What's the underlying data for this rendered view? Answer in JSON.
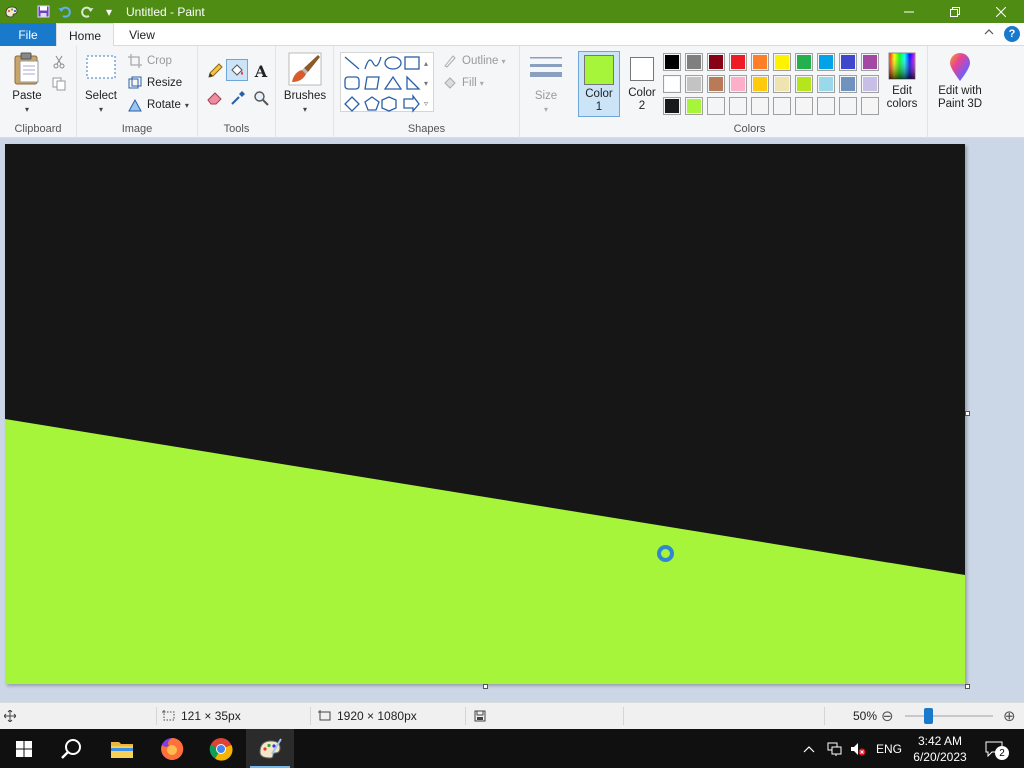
{
  "window": {
    "title": "Untitled - Paint",
    "qat_dropdown_glyph": "▾"
  },
  "tabs": {
    "file": "File",
    "home": "Home",
    "view": "View"
  },
  "clipboard": {
    "paste": "Paste",
    "group": "Clipboard"
  },
  "image": {
    "select": "Select",
    "crop": "Crop",
    "resize": "Resize",
    "rotate": "Rotate",
    "group": "Image"
  },
  "tools": {
    "group": "Tools",
    "text_glyph": "A"
  },
  "brushes": {
    "label": "Brushes"
  },
  "shapes": {
    "outline": "Outline",
    "fill": "Fill",
    "group": "Shapes"
  },
  "size": {
    "label": "Size"
  },
  "colors": {
    "color1_label": "Color",
    "color1_num": "1",
    "color2_label": "Color",
    "color2_num": "2",
    "edit_colors_line1": "Edit",
    "edit_colors_line2": "colors",
    "paint3d_line1": "Edit with",
    "paint3d_line2": "Paint 3D",
    "group": "Colors",
    "color1_value": "#a6f53a",
    "color2_value": "#ffffff",
    "palette_row1": [
      "#000000",
      "#7f7f7f",
      "#880015",
      "#ed1c24",
      "#ff7f27",
      "#fff200",
      "#22b14c",
      "#00a2e8",
      "#3f48cc",
      "#a349a4"
    ],
    "palette_row2": [
      "#ffffff",
      "#c3c3c3",
      "#b97a57",
      "#ffaec9",
      "#ffc90e",
      "#efe4b0",
      "#b5e61d",
      "#99d9ea",
      "#7092be",
      "#c8bfe7"
    ],
    "palette_row3": [
      "#1a1a1a",
      "#a6f53a",
      "#f5f5f5",
      "#f5f5f5",
      "#f5f5f5",
      "#f5f5f5",
      "#f5f5f5",
      "#f5f5f5",
      "#f5f5f5",
      "#f5f5f5"
    ]
  },
  "canvas": {
    "top_color": "#161616",
    "bottom_color": "#a6f53a"
  },
  "status": {
    "selection_size": "121 × 35px",
    "image_size": "1920 × 1080px",
    "zoom": "50%",
    "zoom_out": "⊖",
    "zoom_in": "⊕"
  },
  "taskbar": {
    "language": "ENG",
    "time": "3:42 AM",
    "date": "6/20/2023",
    "notifications": "2"
  }
}
